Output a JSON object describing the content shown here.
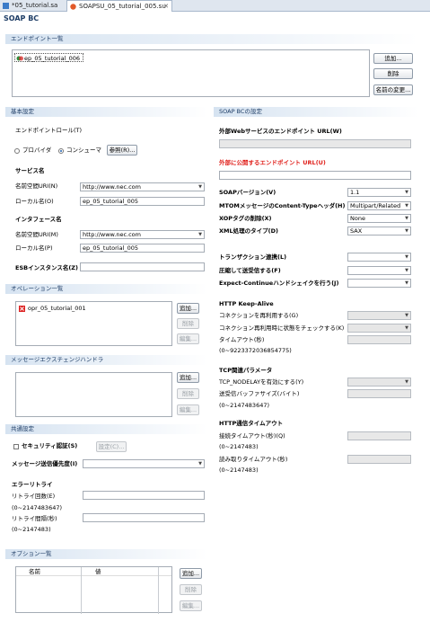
{
  "tabs": [
    {
      "label": "*05_tutorial.sa"
    },
    {
      "label": "SOAPSU_05_tutorial_005.su"
    }
  ],
  "editor_title": "SOAP BC",
  "endpoint_section": {
    "title": "エンドポイント一覧",
    "items": [
      "ep_05_tutorial_006"
    ],
    "add_button": "追加...",
    "delete_button": "削除",
    "rename_button": "名前の変更..."
  },
  "basic_section": {
    "title": "基本設定",
    "role_label": "エンドポイントロール(T)",
    "provider_label": "プロバイダ",
    "consumer_label": "コンシューマ",
    "ref_button": "参照(R)...",
    "service_heading": "サービス名",
    "ns_uri_label": "名前空間URI(N)",
    "ns_uri_value": "http://www.nec.com",
    "local_label": "ローカル名(O)",
    "local_value": "ep_05_tutorial_005",
    "iface_heading": "インタフェース名",
    "iface_ns_label": "名前空間URI(M)",
    "iface_ns_value": "http://www.nec.com",
    "iface_local_label": "ローカル名(P)",
    "iface_local_value": "ep_05_tutorial_005",
    "esb_label": "ESBインスタンス名(Z)"
  },
  "operation_section": {
    "title": "オペレーション一覧",
    "items": [
      "opr_05_tutorial_001"
    ],
    "add_button": "追加...",
    "delete_button": "削除",
    "edit_button": "編集..."
  },
  "handler_section": {
    "title": "メッセージエクスチェンジハンドラ",
    "add_button": "追加...",
    "delete_button": "削除",
    "edit_button": "編集..."
  },
  "common_section": {
    "title": "共通設定",
    "security_label": "セキュリティ認証(S)",
    "settings_button": "設定(C)...",
    "priority_label": "メッセージ送信優先度(I)",
    "error_retry_heading": "エラーリトライ",
    "retry_count_label": "リトライ回数(E)",
    "retry_count_range": "(0~2147483647)",
    "retry_interval_label": "リトライ間隔(秒)",
    "retry_interval_range": "(0~2147483)"
  },
  "option_section": {
    "title": "オプション一覧",
    "col_name": "名前",
    "col_value": "値",
    "add_button": "追加...",
    "delete_button": "削除",
    "edit_button": "編集..."
  },
  "soap_section": {
    "title": "SOAP BCの設定",
    "ext_url_label": "外部Webサービスのエンドポイント URL(W)",
    "pub_url_label": "外部に公開するエンドポイント URL(U)",
    "soap_version_label": "SOAPバージョン(V)",
    "soap_version_value": "1.1",
    "mtom_label": "MTOMメッセージのContent-Typeヘッダ(H)",
    "mtom_value": "Multipart/Related",
    "xop_label": "XOPタグの削除(X)",
    "xop_value": "None",
    "xml_label": "XML処理のタイプ(D)",
    "xml_value": "SAX",
    "transaction_label": "トランザクション連携(L)",
    "compress_label": "圧縮して送受信する(F)",
    "expect_label": "Expect-Continueハンドシェイクを行う(J)",
    "keepalive_heading": "HTTP Keep-Alive",
    "reuse_label": "コネクションを再利用する(G)",
    "reuse_check_label": "コネクション再利用時に状態をチェックする(K)",
    "timeout_label": "タイムアウト(秒)",
    "timeout_range": "(0~9223372036854775)",
    "tcp_heading": "TCP関連パラメータ",
    "nodelay_label": "TCP_NODELAYを有効にする(Y)",
    "buffer_label": "送受信バッファサイズ(バイト)",
    "buffer_range": "(0~2147483647)",
    "http_timeout_heading": "HTTP通信タイムアウト",
    "connect_timeout_label": "接続タイムアウト(秒)(Q)",
    "connect_timeout_range": "(0~2147483)",
    "read_timeout_label": "読み取りタイムアウト(秒)",
    "read_timeout_range": "(0~2147483)"
  }
}
